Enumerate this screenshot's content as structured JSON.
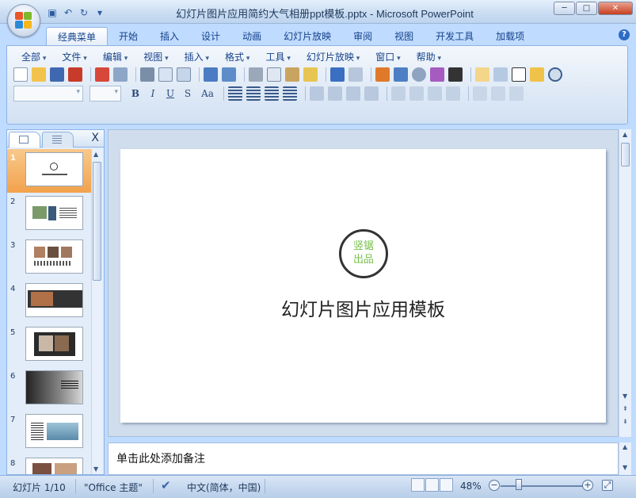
{
  "window": {
    "title": "幻灯片图片应用简约大气相册ppt模板.pptx - Microsoft PowerPoint",
    "minimize": "─",
    "maximize": "□",
    "close": "✕"
  },
  "quick_access": [
    "save-icon",
    "undo-icon",
    "redo-icon",
    "customize-icon"
  ],
  "tabs": [
    "经典菜单",
    "开始",
    "插入",
    "设计",
    "动画",
    "幻灯片放映",
    "审阅",
    "视图",
    "开发工具",
    "加载项"
  ],
  "active_tab": "经典菜单",
  "help_label": "?",
  "menus": [
    "全部",
    "文件",
    "编辑",
    "视图",
    "插入",
    "格式",
    "工具",
    "幻灯片放映",
    "窗口",
    "帮助"
  ],
  "format_buttons": [
    "B",
    "I",
    "U",
    "S",
    "Aa"
  ],
  "slides_panel": {
    "close_label": "X",
    "slides": [
      {
        "num": "1",
        "selected": true
      },
      {
        "num": "2",
        "selected": false
      },
      {
        "num": "3",
        "selected": false
      },
      {
        "num": "4",
        "selected": false
      },
      {
        "num": "5",
        "selected": false
      },
      {
        "num": "6",
        "selected": false
      },
      {
        "num": "7",
        "selected": false
      },
      {
        "num": "8",
        "selected": false
      }
    ]
  },
  "slide": {
    "logo_line1": "竖锯",
    "logo_line2": "出品",
    "title": "幻灯片图片应用模板",
    "logo_color": "#78c04a"
  },
  "notes": {
    "placeholder": "单击此处添加备注"
  },
  "status": {
    "slide_info": "幻灯片 1/10",
    "theme": "\"Office 主题\"",
    "language": "中文(简体，中国)",
    "zoom": "48%",
    "zoom_minus": "−",
    "zoom_plus": "+"
  }
}
